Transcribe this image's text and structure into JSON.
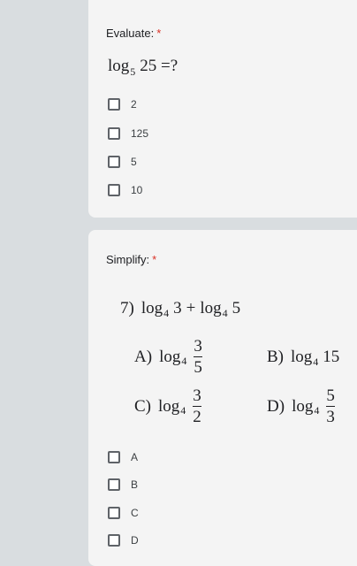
{
  "question1": {
    "title": "Evaluate:",
    "required_mark": "*",
    "equation": {
      "func": "log",
      "base": "5",
      "arg": "25",
      "tail": "=?"
    },
    "options": [
      "2",
      "125",
      "5",
      "10"
    ]
  },
  "question2": {
    "title": "Simplify:",
    "required_mark": "*",
    "problem": {
      "number": "7)",
      "expr": {
        "log1": "log",
        "base1": "4",
        "arg1": "3",
        "plus": "+",
        "log2": "log",
        "base2": "4",
        "arg2": "5"
      },
      "choices": [
        {
          "letter": "A)",
          "log": "log",
          "base": "4",
          "num": "3",
          "den": "5"
        },
        {
          "letter": "B)",
          "log": "log",
          "base": "4",
          "arg": "15"
        },
        {
          "letter": "C)",
          "log": "log",
          "base": "4",
          "num": "3",
          "den": "2"
        },
        {
          "letter": "D)",
          "log": "log",
          "base": "4",
          "num": "5",
          "den": "3"
        }
      ]
    },
    "options": [
      "A",
      "B",
      "C",
      "D"
    ]
  }
}
